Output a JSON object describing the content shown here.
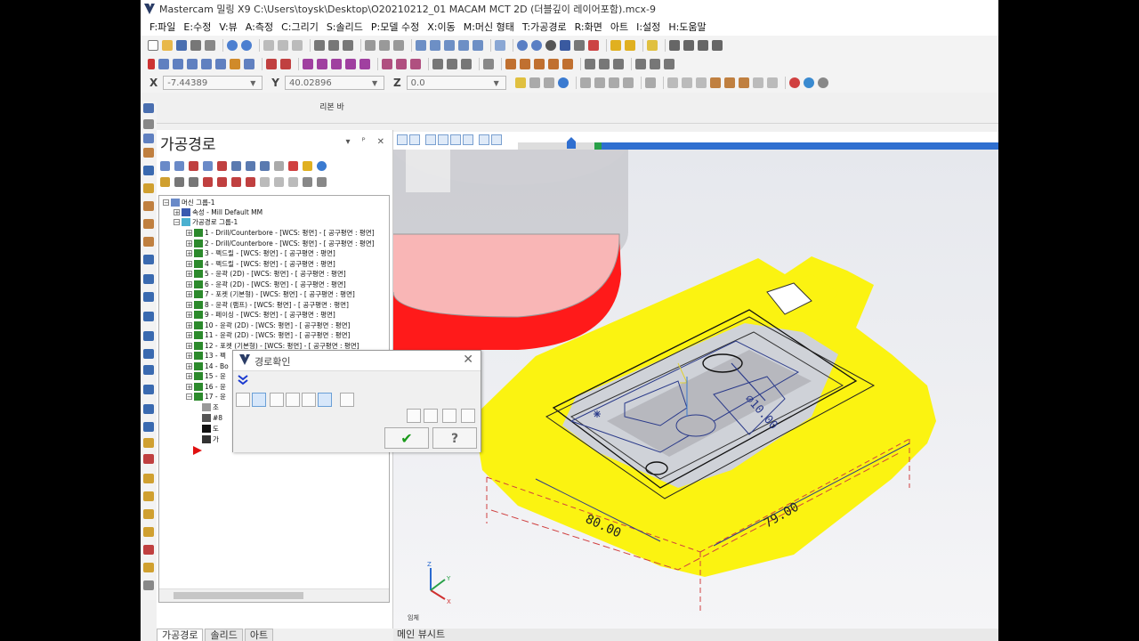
{
  "window": {
    "title": "Mastercam 밀링 X9  C:\\Users\\toysk\\Desktop\\O20210212_01 MACAM MCT 2D (더블깊이 레이어포함).mcx-9"
  },
  "menu": [
    "F:파일",
    "E:수정",
    "V:뷰",
    "A:측정",
    "C:그리기",
    "S:솔리드",
    "P:모델 수정",
    "X:이동",
    "M:머신 형태",
    "T:가공경로",
    "R:화면",
    "아트",
    "I:설정",
    "H:도움말"
  ],
  "coords": {
    "x_label": "X",
    "x_value": "-7.44389",
    "y_label": "Y",
    "y_value": "40.02896",
    "z_label": "Z",
    "z_value": "0.0"
  },
  "ribbon_label": "리본 바",
  "panel": {
    "title": "가공경로",
    "controls": "▾ ᴾ ✕",
    "tree": {
      "machine_group": "머신 그룹-1",
      "properties": "속성 - Mill Default MM",
      "toolpath_group": "가공경로 그룹-1",
      "ops": [
        "1 - Drill/Counterbore - [WCS: 평면] - [ 공구평면 : 평면]",
        "2 - Drill/Counterbore - [WCS: 평면] - [ 공구평면 : 평면]",
        "3 - 펙드릴 - [WCS: 평면] - [ 공구평면 : 평면]",
        "4 - 펙드릴 - [WCS: 평면] - [ 공구평면 : 평면]",
        "5 - 윤곽 (2D) - [WCS: 평면] - [ 공구평면 : 평면]",
        "6 - 윤곽 (2D) - [WCS: 평면] - [ 공구평면 : 평면]",
        "7 - 포켓 (기본형) - [WCS: 평면] - [ 공구평면 : 평면]",
        "8 - 윤곽 (램프) - [WCS: 평면] - [ 공구평면 : 평면]",
        "9 - 페이싱 - [WCS: 평면] - [ 공구평면 : 평면]",
        "10 - 윤곽 (2D) - [WCS: 평면] - [ 공구평면 : 평면]",
        "11 - 윤곽 (2D) - [WCS: 평면] - [ 공구평면 : 평면]",
        "12 - 포켓 (기본형) - [WCS: 평면] - [ 공구평면 : 평면]",
        "13 - 펙",
        "14 - Bo",
        "15 - 윤",
        "16 - 윤",
        "17 - 윤"
      ],
      "op17_children": [
        "조",
        "#8",
        "도",
        "가"
      ]
    },
    "tabs": [
      "가공경로",
      "솔리드",
      "아트"
    ]
  },
  "dialog": {
    "title": "경로확인",
    "ok": "✔",
    "help": "?"
  },
  "viewport": {
    "dim_diameter": "⌀10.00",
    "dim_width": "80.00",
    "dim_depth": "79.00",
    "view_label": "임체",
    "axis_x": "X",
    "axis_y": "Y",
    "axis_z": "Z"
  },
  "statusbar": "메인 뷰시트"
}
